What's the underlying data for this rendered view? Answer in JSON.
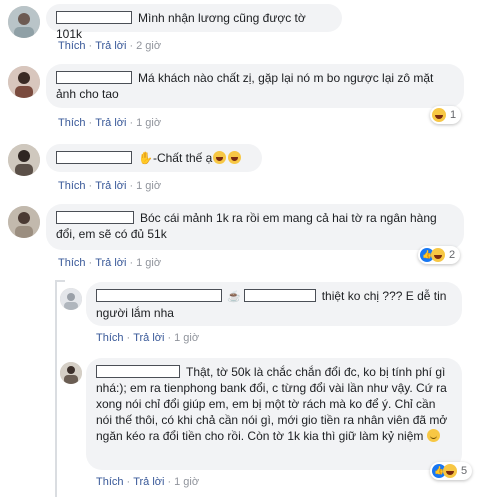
{
  "labels": {
    "like": "Thích",
    "reply": "Trả lời"
  },
  "comments": [
    {
      "text": "Mình nhận lương cũng được tờ 101k",
      "time": "2 giờ"
    },
    {
      "text": "Má khách nào chất zị, gặp lại nó m bo ngược lại zô mặt ảnh cho tao",
      "time": "1 giờ",
      "reaction_count": "1"
    },
    {
      "text": "-Chất thế ạ",
      "time": "1 giờ"
    },
    {
      "text": "Bóc cái mảnh 1k ra rồi em mang cả hai tờ ra ngân hàng đổi, em sẽ có đủ 51k",
      "time": "1 giờ",
      "reaction_count": "2"
    }
  ],
  "replies": [
    {
      "text": "thiệt ko chị ??? E dễ tin người lắm nha",
      "time": "1 giờ"
    },
    {
      "text": "Thật, tờ 50k là chắc chắn đổi đc, ko bị tính phí gì nhá:); em ra tienphong bank đổi, c từng đổi vài lần như vậy. Cứ ra xong nói chỉ đổi giúp em, em bị một tờ rách mà ko để ý. Chỉ cần nói thế thôi, có khi chả cần nói gì, mới gio tiền ra nhân viên đã mở ngăn kéo ra đổi tiền cho rồi. Còn tờ 1k kia thì giữ làm kỷ niệm",
      "time": "1 giờ",
      "reaction_count": "5"
    }
  ],
  "colors": {
    "link": "#385898",
    "bubble": "#f2f3f5",
    "meta": "#90949c"
  }
}
